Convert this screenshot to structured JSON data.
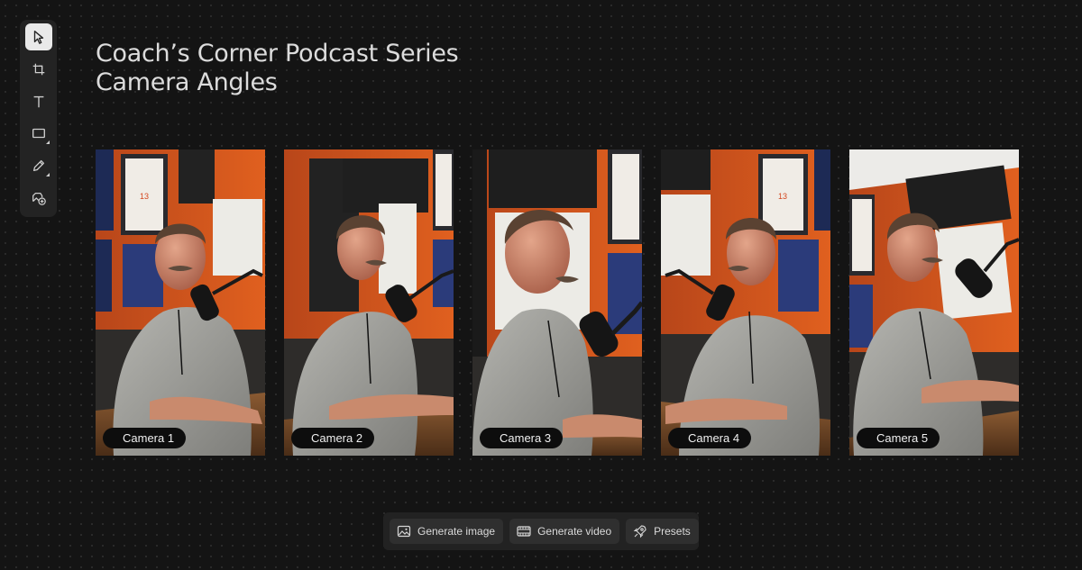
{
  "toolbar": {
    "tools": [
      {
        "icon": "select-arrow-icon",
        "active": true
      },
      {
        "icon": "frame-crop-icon"
      },
      {
        "icon": "text-icon"
      },
      {
        "icon": "rectangle-icon"
      },
      {
        "icon": "pen-icon"
      },
      {
        "icon": "add-image-icon"
      }
    ]
  },
  "header": {
    "title_line1": "Coach’s Corner Podcast Series",
    "title_line2": "Camera Angles"
  },
  "cameras": [
    {
      "label": "Camera 1"
    },
    {
      "label": "Camera 2"
    },
    {
      "label": "Camera 3"
    },
    {
      "label": "Camera 4"
    },
    {
      "label": "Camera 5"
    }
  ],
  "bottom_bar": {
    "generate_image_label": "Generate image",
    "generate_video_label": "Generate video",
    "presets_label": "Presets"
  },
  "colors": {
    "background": "#141414",
    "studio_orange": "#d9561c",
    "shirt_gray": "#9a9a96"
  }
}
